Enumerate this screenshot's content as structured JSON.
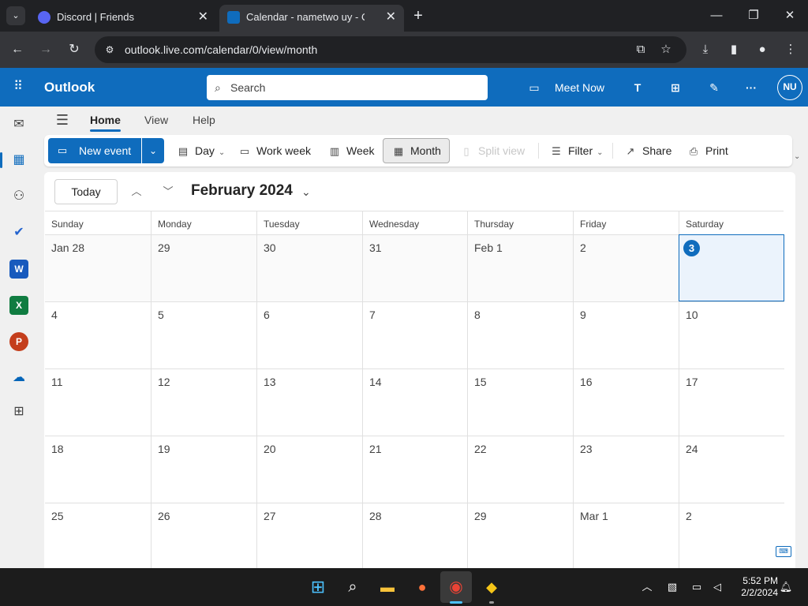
{
  "browser": {
    "tabs": [
      {
        "title": "Discord | Friends",
        "favicon_color": "#5865f2",
        "favicon": "discord-icon"
      },
      {
        "title": "Calendar - nametwo uy - Outlook",
        "favicon_color": "#0f6cbd",
        "favicon": "outlook-icon"
      }
    ],
    "url": "outlook.live.com/calendar/0/view/month"
  },
  "outlook": {
    "app_name": "Outlook",
    "search_placeholder": "Search",
    "meet_now_label": "Meet Now",
    "avatar_initials": "NU",
    "ribbon_tabs": [
      "Home",
      "View",
      "Help"
    ],
    "selected_tab": "Home",
    "commands": {
      "new_event": "New event",
      "day": "Day",
      "work_week": "Work week",
      "week": "Week",
      "month": "Month",
      "split_view": "Split view",
      "filter": "Filter",
      "share": "Share",
      "print": "Print"
    },
    "active_view": "Month"
  },
  "calendar": {
    "today_label": "Today",
    "month_title": "February 2024",
    "weekdays": [
      "Sunday",
      "Monday",
      "Tuesday",
      "Wednesday",
      "Thursday",
      "Friday",
      "Saturday"
    ],
    "weeks": [
      [
        "Jan 28",
        "29",
        "30",
        "31",
        "Feb 1",
        "2",
        "3"
      ],
      [
        "4",
        "5",
        "6",
        "7",
        "8",
        "9",
        "10"
      ],
      [
        "11",
        "12",
        "13",
        "14",
        "15",
        "16",
        "17"
      ],
      [
        "18",
        "19",
        "20",
        "21",
        "22",
        "23",
        "24"
      ],
      [
        "25",
        "26",
        "27",
        "28",
        "29",
        "Mar 1",
        "2"
      ]
    ],
    "selected_day": "3",
    "accent_color": "#0f6cbd"
  },
  "taskbar": {
    "time": "5:52 PM",
    "date": "2/2/2024"
  }
}
